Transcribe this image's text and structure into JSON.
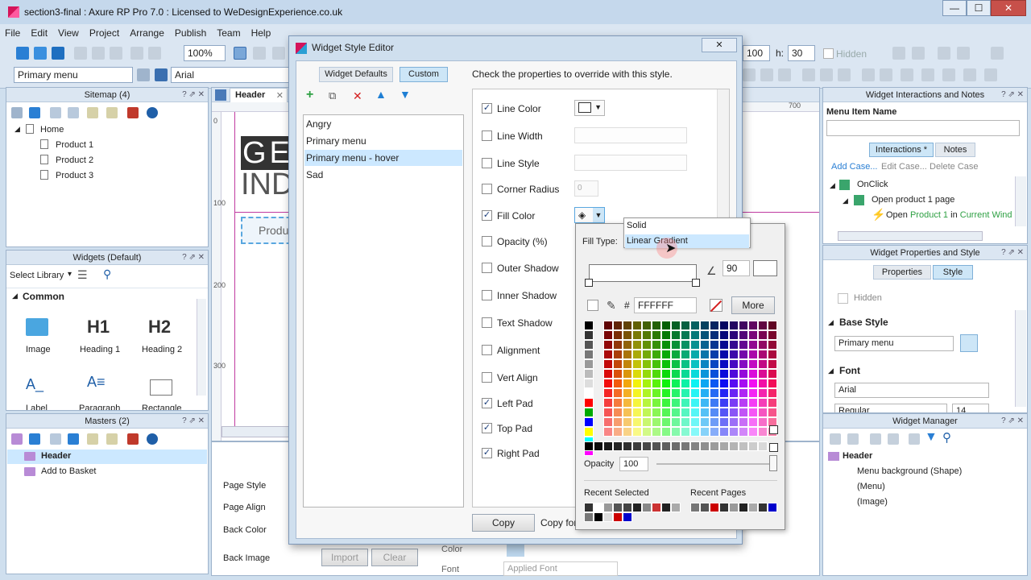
{
  "app": {
    "title": "section3-final : Axure RP Pro 7.0 : Licensed to WeDesignExperience.co.uk",
    "window_buttons": {
      "minimize": "—",
      "maximize": "☐",
      "close": "✕"
    }
  },
  "menu": [
    "File",
    "Edit",
    "View",
    "Project",
    "Arrange",
    "Publish",
    "Team",
    "Help"
  ],
  "toolbar": {
    "zoom": "100%",
    "style_select": "Primary menu",
    "font_select": "Arial",
    "w_value": "100",
    "h_label": "h:",
    "h_value": "30",
    "hidden_label": "Hidden"
  },
  "sitemap": {
    "title": "Sitemap (4)",
    "items": [
      "Home",
      "Product 1",
      "Product 2",
      "Product 3"
    ]
  },
  "widgets": {
    "title": "Widgets (Default)",
    "select_library": "Select Library",
    "section": "Common",
    "items": [
      "Image",
      "Heading 1",
      "Heading 2",
      "Label",
      "Paragraph",
      "Rectangle"
    ],
    "glyphs": {
      "h1": "H1",
      "h2": "H2",
      "label": "A_",
      "paragraph": "A≡"
    }
  },
  "masters": {
    "title": "Masters (2)",
    "items": [
      "Header",
      "Add to Basket"
    ]
  },
  "canvas": {
    "tab": "Header",
    "ruler_top": "700",
    "ruler_left": [
      "0",
      "100",
      "200",
      "300"
    ],
    "big_text_1": "GE",
    "big_text_2": "IND",
    "menu_box": "Produ"
  },
  "page_props": {
    "labels": [
      "Page Style",
      "Page Align",
      "Back Color",
      "Back Image"
    ],
    "import": "Import",
    "clear": "Clear",
    "color_label": "Color",
    "font_label": "Font",
    "applied_font": "Applied Font"
  },
  "dialog": {
    "title": "Widget Style Editor",
    "close": "✕",
    "tabs": {
      "defaults": "Widget Defaults",
      "custom": "Custom"
    },
    "instruction": "Check the properties to override with this style.",
    "styles": [
      "Angry",
      "Primary menu",
      "Primary menu - hover",
      "Sad"
    ],
    "selected_style": "Primary menu - hover",
    "properties": [
      {
        "label": "Line Color",
        "checked": true
      },
      {
        "label": "Line Width",
        "checked": false
      },
      {
        "label": "Line Style",
        "checked": false
      },
      {
        "label": "Corner Radius",
        "checked": false
      },
      {
        "label": "Fill Color",
        "checked": true
      },
      {
        "label": "Opacity (%)",
        "checked": false
      },
      {
        "label": "Outer Shadow",
        "checked": false
      },
      {
        "label": "Inner Shadow",
        "checked": false
      },
      {
        "label": "Text Shadow",
        "checked": false
      },
      {
        "label": "Alignment",
        "checked": false
      },
      {
        "label": "Vert Align",
        "checked": false
      },
      {
        "label": "Left Pad",
        "checked": true
      },
      {
        "label": "Top Pad",
        "checked": true
      },
      {
        "label": "Right Pad",
        "checked": true
      }
    ],
    "corner_radius_value": "0",
    "copy_button": "Copy",
    "copy_for": "Copy for"
  },
  "fill_popup": {
    "fill_type_label": "Fill Type:",
    "options": [
      "Solid",
      "Linear Gradient"
    ],
    "hovered": "Linear Gradient",
    "angle": "90",
    "hash": "#",
    "hex": "FFFFFF",
    "more": "More",
    "opacity_label": "Opacity",
    "opacity_value": "100",
    "recent_selected": "Recent Selected",
    "recent_pages": "Recent Pages"
  },
  "interactions": {
    "title": "Widget Interactions and Notes",
    "name_label": "Menu Item Name",
    "tabs": {
      "interactions": "Interactions *",
      "notes": "Notes"
    },
    "actions": {
      "add": "Add Case...",
      "edit": "Edit Case...",
      "delete": "Delete Case"
    },
    "event": "OnClick",
    "case": "Open product 1 page",
    "action_prefix": "Open ",
    "action_target": "Product 1",
    "action_mid": " in ",
    "action_where": "Current Wind"
  },
  "props_style": {
    "title": "Widget Properties and Style",
    "tabs": {
      "properties": "Properties",
      "style": "Style"
    },
    "hidden": "Hidden",
    "base_style_section": "Base Style",
    "base_style_value": "Primary menu",
    "font_section": "Font",
    "font_value": "Arial",
    "font_weight": "Regular",
    "font_size": "14"
  },
  "widget_manager": {
    "title": "Widget Manager",
    "root": "Header",
    "items": [
      "Menu background (Shape)",
      "(Menu)",
      "(Image)"
    ]
  },
  "colors": {
    "accent": "#3399ff",
    "selected_row": "#cce8ff",
    "tab_active": "#cde6f7"
  }
}
